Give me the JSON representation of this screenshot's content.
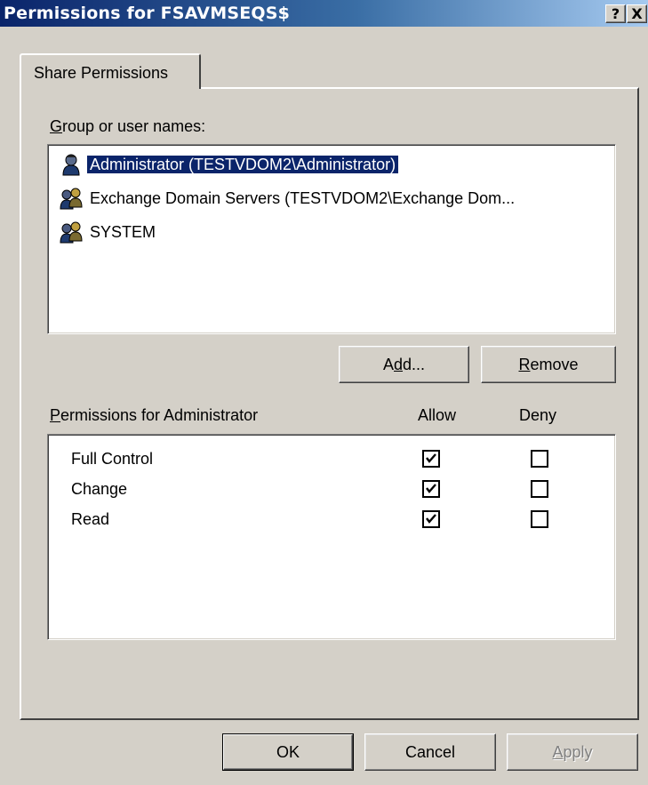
{
  "window": {
    "title": "Permissions for FSAVMSEQS$",
    "help_btn": "?",
    "close_btn": "X"
  },
  "tabs": [
    {
      "label": "Share Permissions",
      "active": true
    }
  ],
  "group_section": {
    "label_prefix": "",
    "label_mnemonic": "G",
    "label_rest": "roup or user names:",
    "users": [
      {
        "name": "Administrator (TESTVDOM2\\Administrator)",
        "icon": "user-icon",
        "selected": true
      },
      {
        "name": "Exchange Domain Servers (TESTVDOM2\\Exchange Dom...",
        "icon": "group-icon",
        "selected": false
      },
      {
        "name": "SYSTEM",
        "icon": "group-icon",
        "selected": false
      }
    ],
    "add_button": {
      "pre": "A",
      "mnemonic": "d",
      "post": "d..."
    },
    "remove_button": {
      "pre": "",
      "mnemonic": "R",
      "post": "emove"
    }
  },
  "permissions_section": {
    "label_mnemonic": "P",
    "label_rest": "ermissions for Administrator",
    "allow_header": "Allow",
    "deny_header": "Deny",
    "rows": [
      {
        "name": "Full Control",
        "allow": true,
        "deny": false
      },
      {
        "name": "Change",
        "allow": true,
        "deny": false
      },
      {
        "name": "Read",
        "allow": true,
        "deny": false
      }
    ]
  },
  "footer": {
    "ok_label": "OK",
    "cancel_label": "Cancel",
    "apply_mnemonic": "A",
    "apply_rest": "pply",
    "apply_disabled": true
  },
  "colors": {
    "title_start": "#0a246a",
    "title_end": "#a6caf0",
    "selection": "#0a246a",
    "face": "#d4d0c8"
  }
}
